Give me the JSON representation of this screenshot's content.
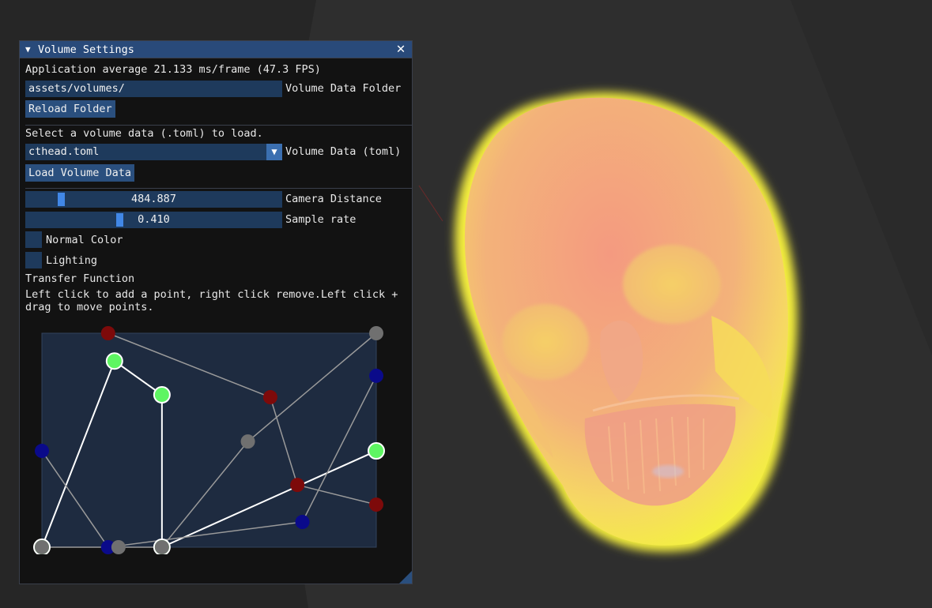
{
  "window": {
    "title": "Volume Settings",
    "collapse_icon": "triangle-down-icon",
    "close_icon": "close-icon",
    "close_glyph": "✕"
  },
  "stats": {
    "fps_text": "Application average 21.133 ms/frame (47.3 FPS)"
  },
  "folder": {
    "value": "assets/volumes/",
    "label": "Volume Data Folder",
    "reload_label": "Reload Folder"
  },
  "volume": {
    "prompt": "Select a volume data (.toml) to load.",
    "selected": "cthead.toml",
    "label": "Volume Data (toml)",
    "load_label": "Load Volume Data"
  },
  "camera_distance": {
    "value_text": "484.887",
    "label": "Camera Distance",
    "fraction": 0.12
  },
  "sample_rate": {
    "value_text": "0.410",
    "label": "Sample rate",
    "fraction": 0.36
  },
  "options": {
    "normal_color_label": "Normal Color",
    "normal_color_checked": false,
    "lighting_label": "Lighting",
    "lighting_checked": false
  },
  "transfer_function": {
    "heading": "Transfer Function",
    "help_text": "Left click to add a point, right click remove.Left click + drag to move points.",
    "panel_color": "#1e2b40",
    "channels": [
      {
        "name": "red",
        "color": "#7d0a0a",
        "line_color": "#9a9a9a",
        "radius": 9,
        "points": [
          [
            0.198,
            1.0
          ],
          [
            0.683,
            0.701
          ],
          [
            0.764,
            0.291
          ],
          [
            1.0,
            0.199
          ]
        ]
      },
      {
        "name": "green",
        "color": "#5ef562",
        "line_color": "#ffffff",
        "radius": 10,
        "stroke": "#ffffff",
        "points": [
          [
            0.0,
            0.0
          ],
          [
            0.217,
            0.87
          ],
          [
            0.359,
            0.712
          ],
          [
            0.359,
            0.0
          ],
          [
            1.0,
            0.45
          ]
        ]
      },
      {
        "name": "blue",
        "color": "#0a0a8a",
        "line_color": "#9a9a9a",
        "radius": 9,
        "points": [
          [
            0.0,
            0.45
          ],
          [
            0.198,
            0.0
          ],
          [
            0.779,
            0.118
          ],
          [
            1.0,
            0.801
          ]
        ]
      },
      {
        "name": "alpha",
        "color": "#707070",
        "line_color": "#9a9a9a",
        "radius": 9,
        "points": [
          [
            0.0,
            0.0
          ],
          [
            0.229,
            0.0
          ],
          [
            0.359,
            0.0
          ],
          [
            0.616,
            0.494
          ],
          [
            1.0,
            1.0
          ]
        ]
      }
    ]
  },
  "render": {
    "background": "#262626",
    "skull_colors": [
      "#f0a080",
      "#f5d060",
      "#ffff40"
    ]
  }
}
